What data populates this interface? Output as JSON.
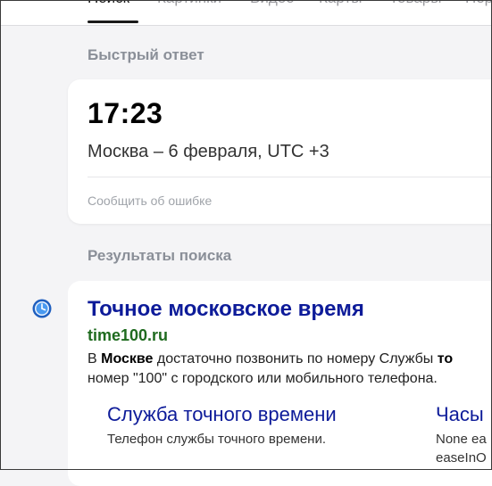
{
  "tabs": [
    {
      "label": "Поиск",
      "active": true
    },
    {
      "label": "Картинки"
    },
    {
      "label": "Видео"
    },
    {
      "label": "Карты"
    },
    {
      "label": "Товары"
    },
    {
      "label": "Пер"
    }
  ],
  "quick_answer": {
    "heading": "Быстрый ответ",
    "time": "17:23",
    "location": "Москва – 6 февраля, UTC +3",
    "report_link": "Сообщить об ошибке"
  },
  "results": {
    "heading": "Результаты поиска",
    "items": [
      {
        "favicon": "clock-icon",
        "title": "Точное московское время",
        "url": "time100.ru",
        "snippet_line1_pre": "В ",
        "snippet_line1_bold": "Москве",
        "snippet_line1_post": " достаточно позвонить по номеру Службы ",
        "snippet_line1_bold2": "то",
        "snippet_line2": "номер \"100\" с городского или мобильного телефона.",
        "sitelinks": [
          {
            "title": "Служба точного времени",
            "desc": "Телефон службы точного времени."
          },
          {
            "title": "Часы",
            "desc_line1": "None ea",
            "desc_line2": "easeInO"
          }
        ]
      }
    ]
  },
  "colors": {
    "link": "#0d1b99",
    "url_green": "#1f6b1f",
    "muted": "#8a8f98"
  }
}
